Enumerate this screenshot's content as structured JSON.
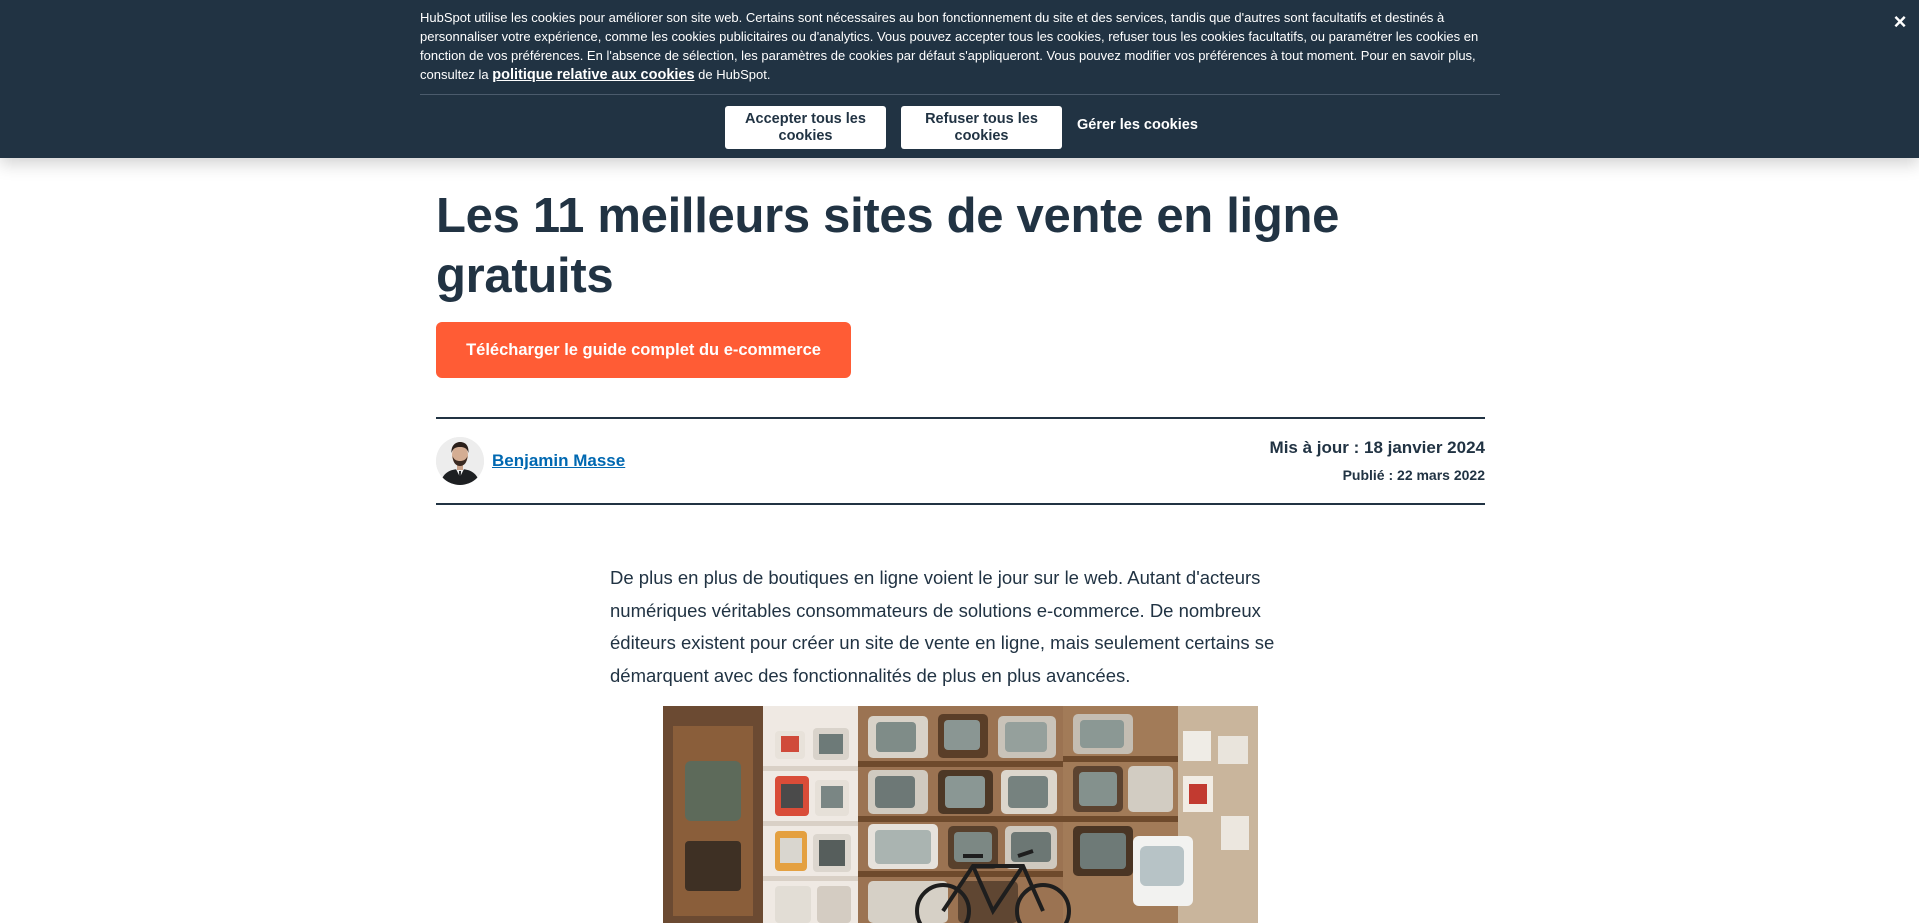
{
  "cookie_banner": {
    "text": "HubSpot utilise les cookies pour améliorer son site web. Certains sont nécessaires au bon fonctionnement du site et des services, tandis que d'autres sont facultatifs et destinés à personnaliser votre expérience, comme les cookies publicitaires ou d'analytics. Vous pouvez accepter tous les cookies, refuser tous les cookies facultatifs, ou paramétrer les cookies en fonction de vos préférences. En l'absence de sélection, les paramètres de cookies par défaut s'appliqueront. Vous pouvez modifier vos préférences à tout moment. Pour en savoir plus, consultez la",
    "policy_link": "politique relative aux cookies",
    "text_suffix": "de HubSpot.",
    "accept_label": "Accepter tous les cookies",
    "refuse_label": "Refuser tous les cookies",
    "manage_label": "Gérer les cookies",
    "close_icon": "×"
  },
  "article": {
    "title": "Les 11 meilleurs sites de vente en ligne gratuits",
    "cta_label": "Télécharger le guide complet du e-commerce",
    "author_name": "Benjamin Masse",
    "updated": "Mis à jour : 18 janvier 2024",
    "published": "Publié : 22 mars 2022",
    "intro": "De plus en plus de boutiques en ligne voient le jour sur le web. Autant d'acteurs numériques véritables consommateurs de solutions e-commerce. De nombreux éditeurs existent pour créer un site de vente en ligne, mais seulement certains se démarquent avec des fonctionnalités de plus en plus avancées."
  },
  "colors": {
    "banner_bg": "#213343",
    "text_dark": "#213343",
    "cta_bg": "#ff5c35",
    "link": "#0068b1"
  }
}
